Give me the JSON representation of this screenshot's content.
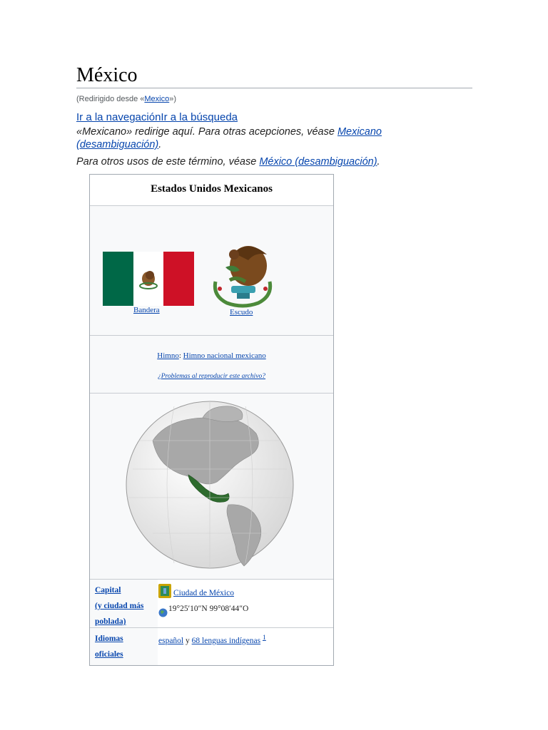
{
  "article": {
    "title": "México",
    "redirect_prefix": "(Redirigido desde «",
    "redirect_link": "Mexico",
    "redirect_suffix": "»)",
    "jump_nav": "Ir a la navegación",
    "jump_search": "Ir a la búsqueda",
    "hatnote1_text": "«Mexicano» redirige aquí. Para otras acepciones, véase ",
    "hatnote1_link": "Mexicano (desambiguación)",
    "hatnote1_end": ".",
    "hatnote2_text": "Para otros usos de este término, véase ",
    "hatnote2_link": "México (desambiguación)",
    "hatnote2_end": "."
  },
  "infobox": {
    "title": "Estados Unidos Mexicanos",
    "flag_label": "Bandera",
    "coat_label": "Escudo",
    "anthem_label": "Himno",
    "anthem_sep": ": ",
    "anthem_name": "Himno nacional mexicano",
    "anthem_help": "¿Problemas al reproducir este archivo?",
    "capital_label_1": "Capital",
    "capital_label_2": "(y ciudad más",
    "capital_label_3": "poblada)",
    "capital_value": "Ciudad de México",
    "coordinates": "19°25′10″N 99°08′44″O",
    "idiomas_label_1": "Idiomas",
    "idiomas_label_2": "oficiales",
    "idiomas_value_1": "español",
    "idiomas_and": " y ",
    "idiomas_value_2": "68 lenguas indígenas",
    "idiomas_ref": "1"
  },
  "colors": {
    "link": "#0645ad",
    "flag_green": "#006847",
    "flag_white": "#ffffff",
    "flag_red": "#ce1126",
    "mexico_highlight": "#2e6b2e"
  }
}
